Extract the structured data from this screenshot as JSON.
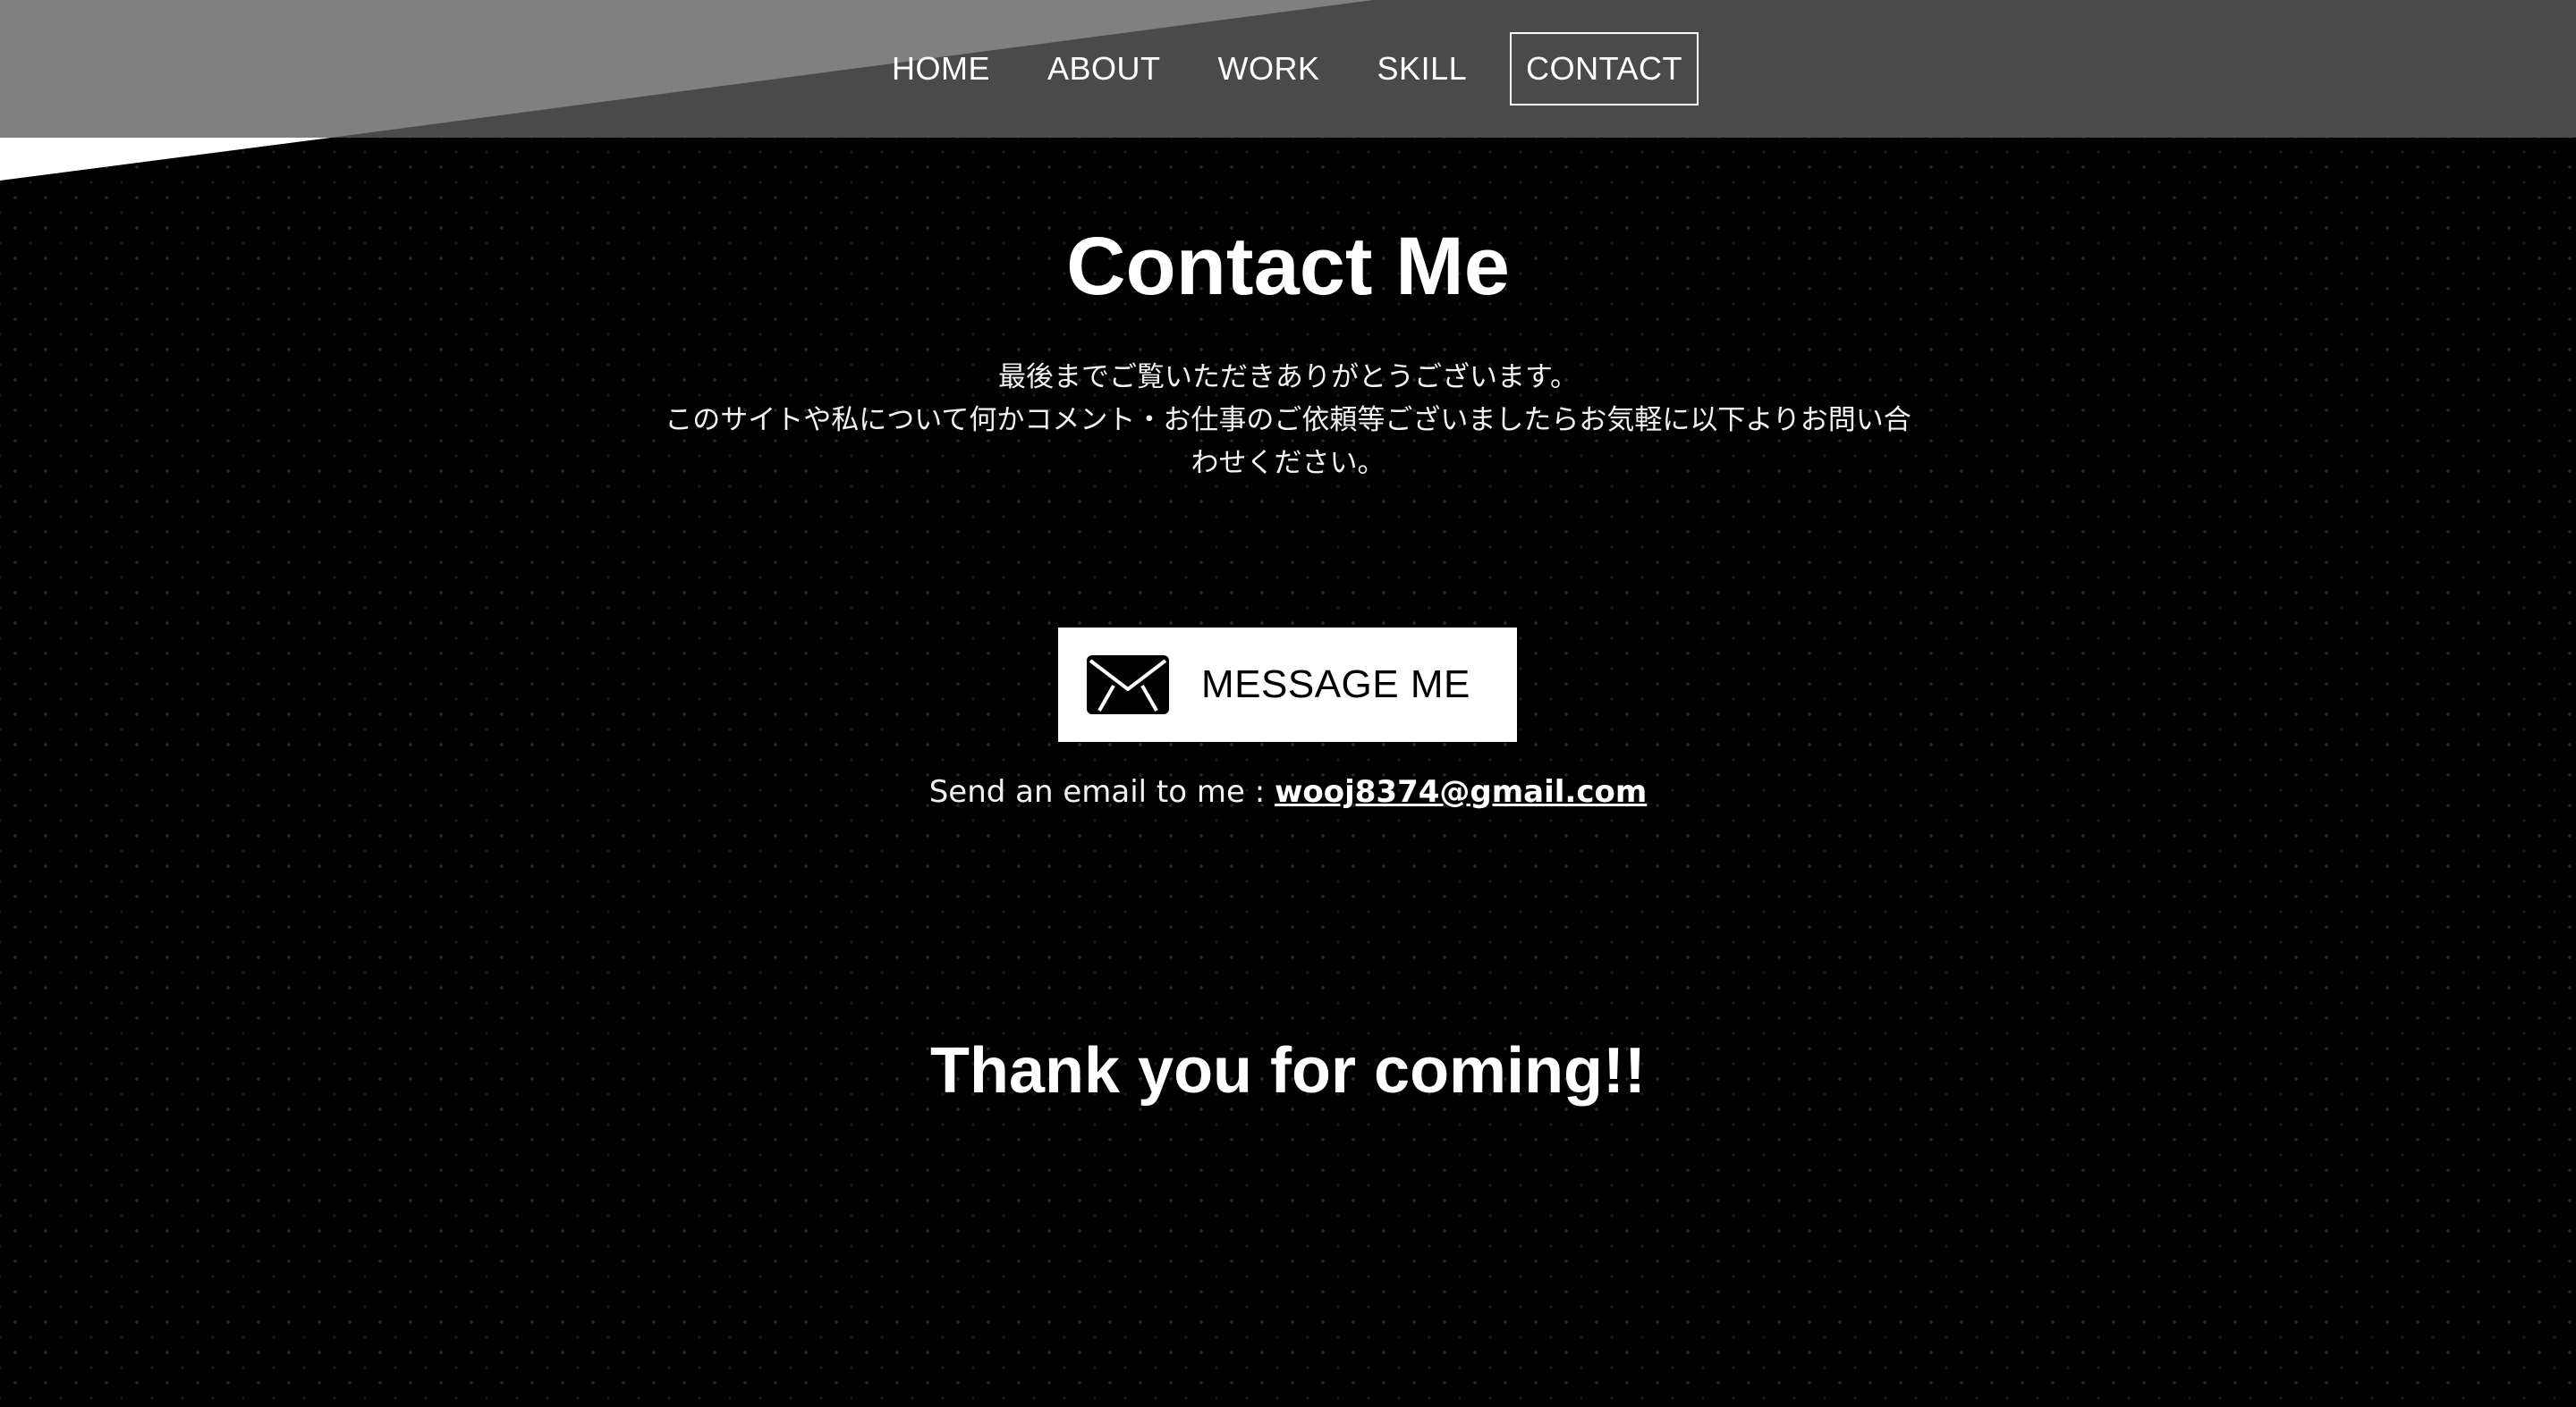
{
  "nav": {
    "items": [
      {
        "label": "HOME"
      },
      {
        "label": "ABOUT"
      },
      {
        "label": "WORK"
      },
      {
        "label": "SKILL"
      },
      {
        "label": "CONTACT",
        "active": true
      }
    ]
  },
  "contact": {
    "title": "Contact Me",
    "description": [
      "最後までご覧いただきありがとうございます。",
      "このサイトや私について何かコメント・お仕事のご依頼等ございましたらお気軽に以下よりお問い合",
      "わせください。"
    ],
    "message_button": {
      "label": "MESSAGE ME",
      "icon": "envelope-icon"
    },
    "email_prefix": "Send an email to me : ",
    "email": "wooj8374@gmail.com"
  },
  "footer": {
    "thanks": "Thank you for coming!!"
  },
  "colors": {
    "background": "#000000",
    "header_dark": "#4a4a4a",
    "header_light": "#808080",
    "text": "#ffffff"
  }
}
